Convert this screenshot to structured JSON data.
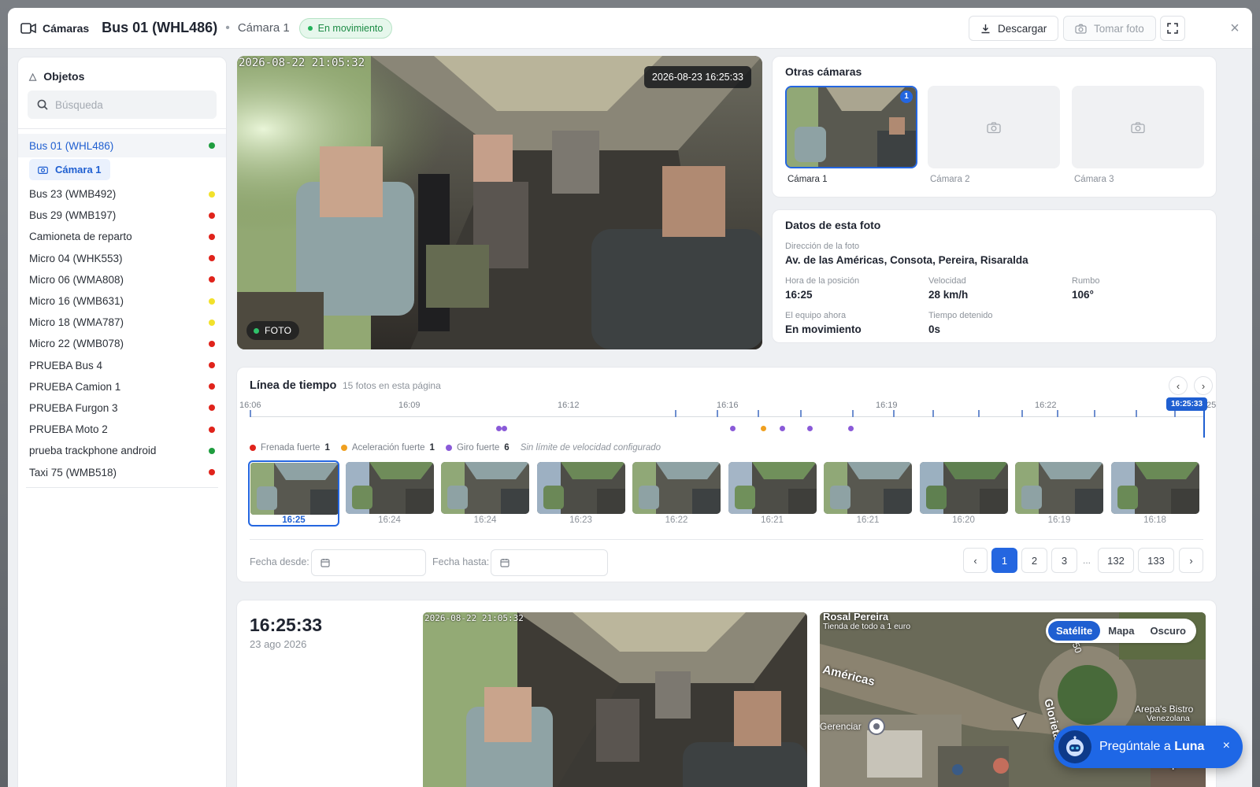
{
  "header": {
    "app_label": "Cámaras",
    "vehicle": "Bus 01 (WHL486)",
    "separator": "•",
    "camera": "Cámara 1",
    "status": "En movimiento",
    "download_label": "Descargar",
    "take_photo_label": "Tomar foto",
    "close_symbol": "×"
  },
  "sidebar": {
    "title": "Objetos",
    "search_placeholder": "Búsqueda",
    "active_sub_camera": "Cámara 1",
    "items": [
      {
        "label": "Bus 01 (WHL486)",
        "status_color": "#1f9d3f"
      },
      {
        "label": "Bus 23 (WMB492)",
        "status_color": "#f2e12b"
      },
      {
        "label": "Bus 29 (WMB197)",
        "status_color": "#e0231b"
      },
      {
        "label": "Camioneta de reparto",
        "status_color": "#e0231b"
      },
      {
        "label": "Micro 04 (WHK553)",
        "status_color": "#e0231b"
      },
      {
        "label": "Micro 06 (WMA808)",
        "status_color": "#e0231b"
      },
      {
        "label": "Micro 16 (WMB631)",
        "status_color": "#f2e12b"
      },
      {
        "label": "Micro 18 (WMA787)",
        "status_color": "#f2e12b"
      },
      {
        "label": "Micro 22 (WMB078)",
        "status_color": "#e0231b"
      },
      {
        "label": "PRUEBA Bus 4",
        "status_color": "#e0231b"
      },
      {
        "label": "PRUEBA Camion 1",
        "status_color": "#e0231b"
      },
      {
        "label": "PRUEBA Furgon 3",
        "status_color": "#e0231b"
      },
      {
        "label": "PRUEBA Moto 2",
        "status_color": "#e0231b"
      },
      {
        "label": "prueba trackphone android",
        "status_color": "#1f9d3f"
      },
      {
        "label": "Taxi 75 (WMB518)",
        "status_color": "#e0231b"
      }
    ]
  },
  "photo": {
    "osd_text": "2026-08-22 21:05:32",
    "timestamp": "2026-08-23 16:25:33",
    "badge": "FOTO"
  },
  "other_cameras": {
    "title": "Otras cámaras",
    "cameras": [
      {
        "label": "Cámara 1",
        "badge": "1"
      },
      {
        "label": "Cámara 2"
      },
      {
        "label": "Cámara 3"
      }
    ]
  },
  "photo_data": {
    "title": "Datos de esta foto",
    "address_label": "Dirección de la foto",
    "address": "Av. de las Américas, Consota, Pereira, Risaralda",
    "pos_time_label": "Hora de la posición",
    "pos_time": "16:25",
    "speed_label": "Velocidad",
    "speed": "28 km/h",
    "heading_label": "Rumbo",
    "heading": "106°",
    "device_label": "El equipo ahora",
    "device": "En movimiento",
    "stopped_label": "Tiempo detenido",
    "stopped": "0s"
  },
  "timeline": {
    "title": "Línea de tiempo",
    "subtitle": "15 fotos en esta página",
    "prev": "‹",
    "next": "›",
    "ticks": [
      "16:06",
      "16:09",
      "16:12",
      "16:16",
      "16:19",
      "16:22",
      "25"
    ],
    "now_label": "16:25:33",
    "legend": {
      "hard_brake": "Frenada fuerte",
      "hard_brake_count": "1",
      "hard_accel": "Aceleración fuerte",
      "hard_accel_count": "1",
      "hard_turn": "Giro fuerte",
      "hard_turn_count": "6",
      "no_limit": "Sin límite de velocidad configurado"
    },
    "colors": {
      "brake": "#e0231b",
      "accel": "#f0a020",
      "turn": "#8a5ad8"
    },
    "thumbs": [
      "16:25",
      "16:24",
      "16:24",
      "16:23",
      "16:22",
      "16:21",
      "16:21",
      "16:20",
      "16:19",
      "16:18"
    ],
    "date_from_label": "Fecha desde:",
    "date_to_label": "Fecha hasta:",
    "pages": [
      "‹",
      "1",
      "2",
      "3",
      "...",
      "132",
      "133",
      "›"
    ]
  },
  "detail": {
    "time": "16:25:33",
    "date": "23 ago 2026",
    "osd_text": "2026-08-22 21:05:32",
    "map_modes": [
      "Satélite",
      "Mapa",
      "Oscuro"
    ],
    "map_labels": [
      "Rosal Pereira",
      "Tienda de todo a 1 euro",
      "Américas",
      "Glorieta",
      "Arepa's Bistro",
      "Venezolana",
      "Gerenciar",
      "50"
    ],
    "zoom_in": "+"
  },
  "assistant": {
    "prefix": "Pregúntale a ",
    "name": "Luna",
    "close": "×"
  }
}
